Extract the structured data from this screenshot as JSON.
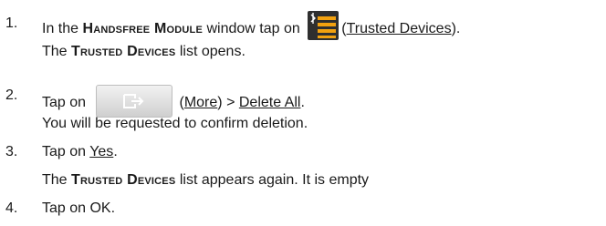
{
  "steps": [
    {
      "number": "1.",
      "line1": {
        "prefix": "In the",
        "module_name": "Handsfree Module",
        "middle": "window tap on",
        "icon": "trusted-devices-icon",
        "icon_label": "Trusted Devices",
        "suffix": "."
      },
      "line2": {
        "prefix": "The",
        "list_name": "Trusted Devices",
        "suffix": "list opens."
      }
    },
    {
      "number": "2.",
      "line1": {
        "prefix": "Tap on",
        "icon": "more-button-icon",
        "icon_label": "More",
        "separator": ">",
        "action_label": "Delete All",
        "suffix": "."
      },
      "line2": {
        "text": "You will be requested to confirm deletion."
      }
    },
    {
      "number": "3.",
      "line1": {
        "prefix": "Tap on",
        "link_label": "Yes",
        "suffix": "."
      },
      "line2": {
        "prefix": "The",
        "list_name": "Trusted Devices",
        "suffix": "list appears again. It is empty"
      }
    },
    {
      "number": "4.",
      "line1": {
        "text": "Tap on OK."
      }
    }
  ],
  "colors": {
    "text": "#1a1a1a",
    "devices_icon_bg": "#2f2f2f",
    "devices_icon_bars": "#f2a10f",
    "more_button_bg": "#e0e0e0"
  }
}
